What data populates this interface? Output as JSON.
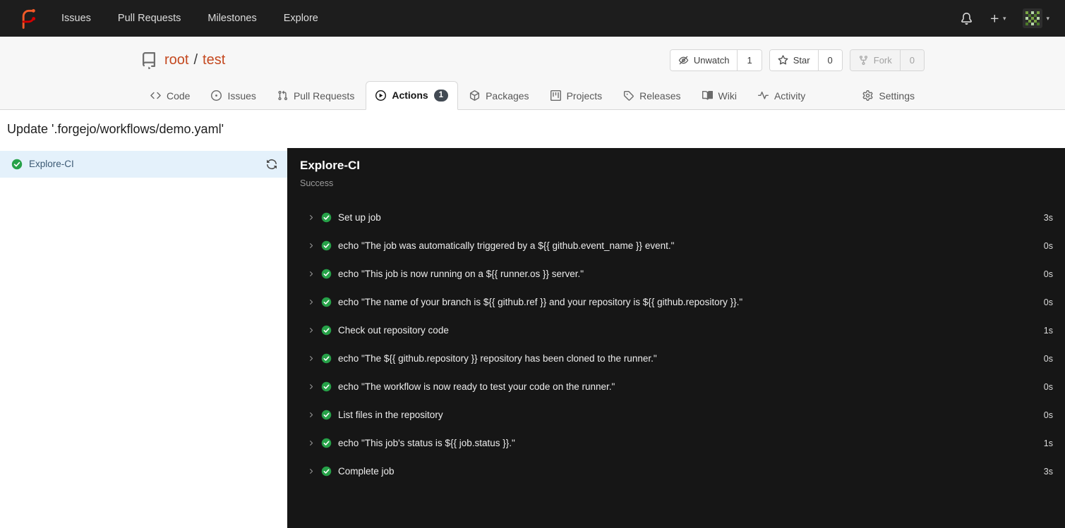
{
  "colors": {
    "accent_red": "#c4481f",
    "success_green": "#26a148",
    "navbar_bg": "#1d1d1d",
    "log_panel_bg": "#161616",
    "selected_job_bg": "#e4f1fb",
    "tab_badge_bg": "#424a53"
  },
  "navbar": {
    "items": [
      "Issues",
      "Pull Requests",
      "Milestones",
      "Explore"
    ]
  },
  "repo_header": {
    "owner": "root",
    "separator": "/",
    "name": "test",
    "buttons": {
      "unwatch": {
        "label": "Unwatch",
        "count": "1"
      },
      "star": {
        "label": "Star",
        "count": "0"
      },
      "fork": {
        "label": "Fork",
        "count": "0"
      }
    }
  },
  "tabs": {
    "items": [
      {
        "label": "Code"
      },
      {
        "label": "Issues"
      },
      {
        "label": "Pull Requests"
      },
      {
        "label": "Actions",
        "badge": "1"
      },
      {
        "label": "Packages"
      },
      {
        "label": "Projects"
      },
      {
        "label": "Releases"
      },
      {
        "label": "Wiki"
      },
      {
        "label": "Activity"
      }
    ],
    "settings": {
      "label": "Settings"
    }
  },
  "run": {
    "title": "Update '.forgejo/workflows/demo.yaml'",
    "job_list": [
      {
        "name": "Explore-CI"
      }
    ],
    "job_detail": {
      "name": "Explore-CI",
      "status": "Success",
      "steps": [
        {
          "name": "Set up job",
          "duration": "3s"
        },
        {
          "name": "echo \"The job was automatically triggered by a ${{ github.event_name }} event.\"",
          "duration": "0s"
        },
        {
          "name": "echo \"This job is now running on a ${{ runner.os }} server.\"",
          "duration": "0s"
        },
        {
          "name": "echo \"The name of your branch is ${{ github.ref }} and your repository is ${{ github.repository }}.\"",
          "duration": "0s"
        },
        {
          "name": "Check out repository code",
          "duration": "1s"
        },
        {
          "name": "echo \"The ${{ github.repository }} repository has been cloned to the runner.\"",
          "duration": "0s"
        },
        {
          "name": "echo \"The workflow is now ready to test your code on the runner.\"",
          "duration": "0s"
        },
        {
          "name": "List files in the repository",
          "duration": "0s"
        },
        {
          "name": "echo \"This job's status is ${{ job.status }}.\"",
          "duration": "1s"
        },
        {
          "name": "Complete job",
          "duration": "3s"
        }
      ]
    }
  }
}
